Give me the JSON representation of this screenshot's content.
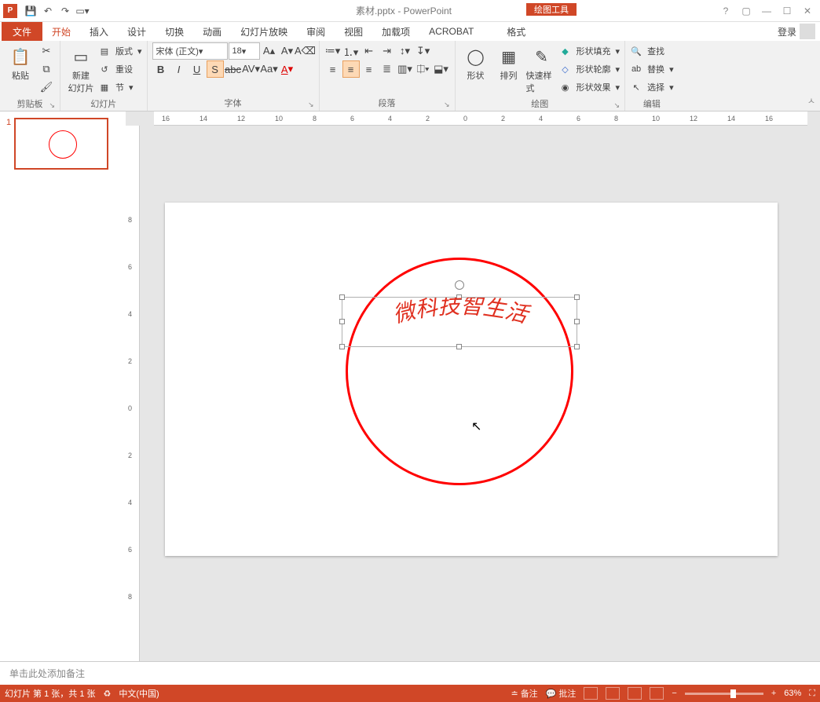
{
  "title": "素材.pptx - PowerPoint",
  "tool_context": "绘图工具",
  "login": "登录",
  "tabs": {
    "file": "文件",
    "home": "开始",
    "insert": "插入",
    "design": "设计",
    "trans": "切换",
    "anim": "动画",
    "show": "幻灯片放映",
    "review": "审阅",
    "view": "视图",
    "addin": "加载项",
    "acrobat": "ACROBAT",
    "format": "格式"
  },
  "groups": {
    "clipboard": "剪贴板",
    "slides": "幻灯片",
    "font": "字体",
    "paragraph": "段落",
    "drawing": "绘图",
    "editing": "编辑"
  },
  "btns": {
    "paste": "粘贴",
    "newslide": "新建\n幻灯片",
    "layout": "版式",
    "reset": "重设",
    "section": "节",
    "shapes": "形状",
    "arrange": "排列",
    "quickstyle": "快速样式",
    "shapefill": "形状填充",
    "shapeoutline": "形状轮廓",
    "shapeeffects": "形状效果",
    "find": "查找",
    "replace": "替换",
    "select": "选择"
  },
  "font": {
    "name": "宋体 (正文)",
    "size": "18"
  },
  "slide_canvas_text": "微科技智生活",
  "notes_placeholder": "单击此处添加备注",
  "status": {
    "slide": "幻灯片 第 1 张，共 1 张",
    "lang": "中文(中国)",
    "notes": "备注",
    "comments": "批注",
    "zoom": "63%"
  },
  "thumb_num": "1",
  "ruler_h": [
    "16",
    "14",
    "12",
    "10",
    "8",
    "6",
    "4",
    "2",
    "0",
    "2",
    "4",
    "6",
    "8",
    "10",
    "12",
    "14",
    "16"
  ],
  "ruler_v": [
    "8",
    "6",
    "4",
    "2",
    "0",
    "2",
    "4",
    "6",
    "8"
  ]
}
